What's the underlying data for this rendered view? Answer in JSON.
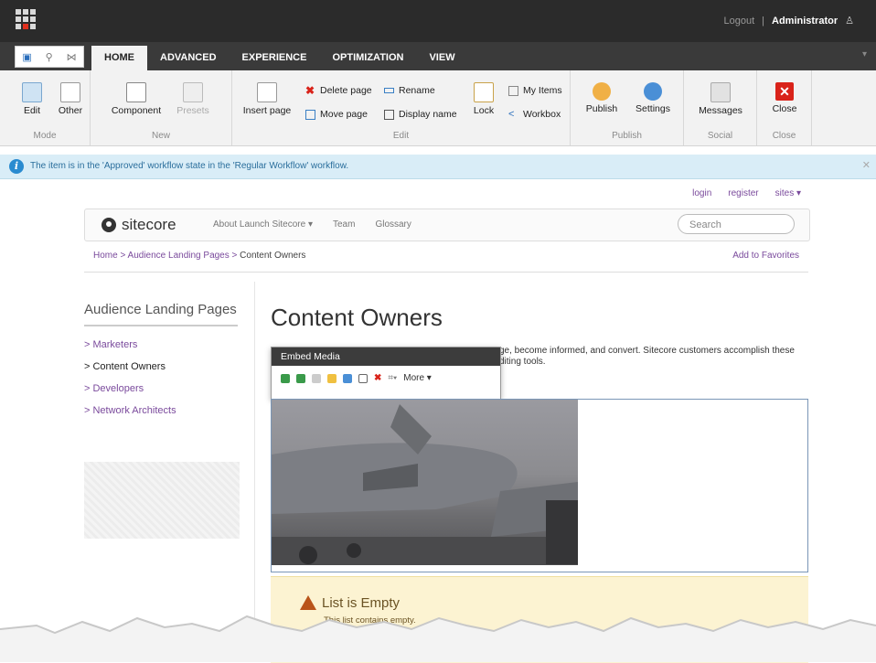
{
  "topbar": {
    "logout": "Logout",
    "separator": "|",
    "user": "Administrator"
  },
  "tabs": [
    "HOME",
    "ADVANCED",
    "EXPERIENCE",
    "OPTIMIZATION",
    "VIEW"
  ],
  "ribbon": {
    "mode": {
      "label": "Mode",
      "edit": "Edit",
      "other": "Other"
    },
    "new": {
      "label": "New",
      "component": "Component",
      "presets": "Presets"
    },
    "edit": {
      "label": "Edit",
      "insert_page": "Insert page",
      "delete_page": "Delete page",
      "move_page": "Move page",
      "rename": "Rename",
      "display_name": "Display name",
      "lock": "Lock",
      "my_items": "My Items",
      "workbox": "Workbox"
    },
    "publish": {
      "label": "Publish",
      "publish": "Publish",
      "settings": "Settings"
    },
    "social": {
      "label": "Social",
      "messages": "Messages"
    },
    "close": {
      "label": "Close",
      "close": "Close"
    }
  },
  "info": {
    "message": "The item is in the 'Approved' workflow state in the 'Regular Workflow' workflow."
  },
  "site": {
    "toplinks": [
      "login",
      "register",
      "sites ▾"
    ],
    "brand": "sitecore",
    "nav": [
      "About Launch Sitecore ▾",
      "Team",
      "Glossary"
    ],
    "search_placeholder": "Search",
    "breadcrumb": {
      "home": "Home",
      "sep": ">",
      "mid": "Audience Landing Pages",
      "current": "Content Owners"
    },
    "favorites": "Add to Favorites",
    "sidebar_title": "Audience Landing Pages",
    "sidebar_items": [
      "> Marketers",
      "> Content Owners",
      "> Developers",
      "> Network Architects"
    ],
    "page_title": "Content Owners",
    "body_text": "ge, become informed, and convert. Sitecore customers accomplish these  diting tools.",
    "embed_title": "Embed Media",
    "embed_more": "More ▾",
    "warn_title": "List is Empty",
    "warn_text": "This list contains empty."
  }
}
